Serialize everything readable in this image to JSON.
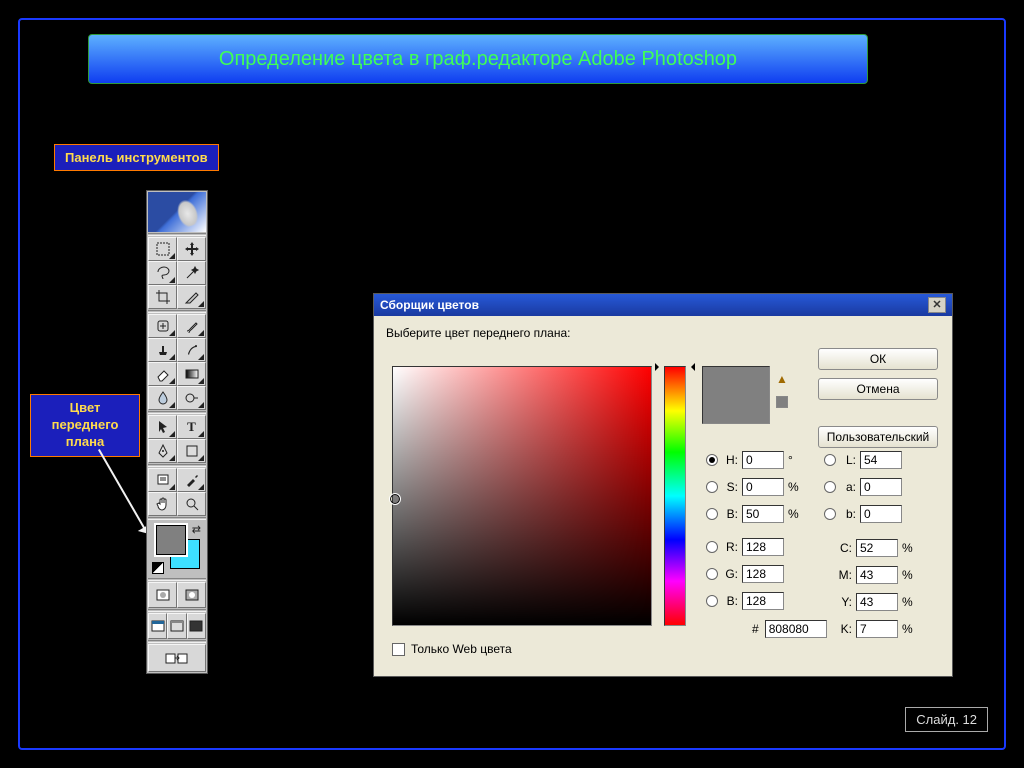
{
  "title": "Определение цвета в граф.редакторе Adobe Photoshop",
  "tags": {
    "tools": "Панель инструментов",
    "fgcolor": "Цвет переднего плана"
  },
  "slide": "Слайд. 12",
  "toolbox": {
    "fg_color": "#808080",
    "bg_color": "#3de0ff"
  },
  "picker": {
    "title": "Сборщик цветов",
    "prompt": "Выберите цвет переднего плана:",
    "buttons": {
      "ok": "ОК",
      "cancel": "Отмена",
      "custom": "Пользовательский"
    },
    "hsb": {
      "H": "0",
      "S": "0",
      "B": "50"
    },
    "lab": {
      "L": "54",
      "a": "0",
      "b": "0"
    },
    "rgb": {
      "R": "128",
      "G": "128",
      "B": "128"
    },
    "cmyk": {
      "C": "52",
      "M": "43",
      "Y": "43",
      "K": "7"
    },
    "hex": "808080",
    "unit_deg": "°",
    "unit_pct": "%",
    "labels": {
      "H": "H:",
      "S": "S:",
      "Bhsb": "B:",
      "L": "L:",
      "a": "a:",
      "blab": "b:",
      "R": "R:",
      "G": "G:",
      "Brgb": "B:",
      "C": "C:",
      "M": "M:",
      "Y": "Y:",
      "K": "K:",
      "hash": "#"
    },
    "web_only": "Только Web цвета"
  }
}
